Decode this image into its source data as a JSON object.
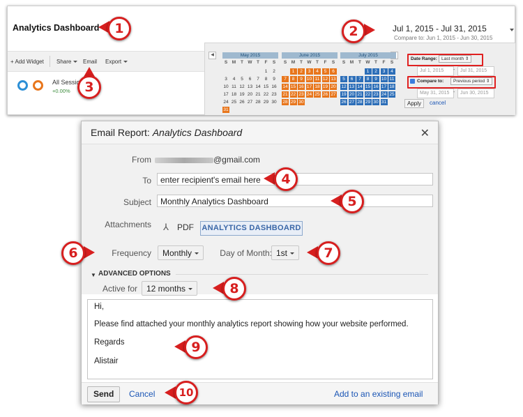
{
  "dashboard": {
    "title": "Analytics Dashboard",
    "toolbar": {
      "add_widget": "+ Add Widget",
      "share": "Share",
      "email": "Email",
      "export": "Export"
    },
    "sessions_label": "All Sessio",
    "sessions_change": "+0.00%",
    "circle_colors": {
      "blue": "#2c8fd6",
      "orange": "#e8761c"
    }
  },
  "date_range": {
    "main": "Jul 1, 2015 - Jul 31, 2015",
    "compare": "Compare to: Jun 1, 2015 - Jun 30, 2015"
  },
  "calendar": {
    "months": [
      "May 2015",
      "June 2015",
      "July 2015"
    ],
    "weekdays": [
      "S",
      "M",
      "T",
      "W",
      "T",
      "F",
      "S"
    ],
    "colors": {
      "orange": "#e8761c",
      "blue": "#2c6eb8"
    }
  },
  "picker_controls": {
    "date_range_label": "Date Range:",
    "date_range_value": "Last month",
    "start": "Jul 1, 2015",
    "end": "Jul 31, 2015",
    "compare_label": "Compare to:",
    "compare_value": "Previous period",
    "compare_start": "May 31, 2015",
    "compare_end": "Jun 30, 2015",
    "dash": "-",
    "apply": "Apply",
    "cancel": "cancel"
  },
  "dialog": {
    "title_prefix": "Email Report: ",
    "title_name": "Analytics Dashboard",
    "close": "✕",
    "from_label": "From",
    "from_suffix": "@gmail.com",
    "to_label": "To",
    "to_value": "enter recipient's email here",
    "subject_label": "Subject",
    "subject_value": "Monthly Analytics Dashboard",
    "attachments_label": "Attachments",
    "pdf_label": "PDF",
    "attachment_chip": "ANALYTICS DASHBOARD",
    "frequency_label": "Frequency",
    "frequency_value": "Monthly",
    "day_of_month_label": "Day of Month:",
    "day_of_month_value": "1st",
    "advanced_label": "ADVANCED OPTIONS",
    "active_for_label": "Active for",
    "active_for_value": "12 months",
    "message_lines": [
      "Hi,",
      "Please find attached your monthly analytics report showing how your website performed.",
      "Regards",
      "Alistair"
    ],
    "send": "Send",
    "cancel": "Cancel",
    "add_existing": "Add to an existing email"
  },
  "callouts": [
    "1",
    "2",
    "3",
    "4",
    "5",
    "6",
    "7",
    "8",
    "9",
    "10"
  ],
  "accent_color": "#d71f1f"
}
